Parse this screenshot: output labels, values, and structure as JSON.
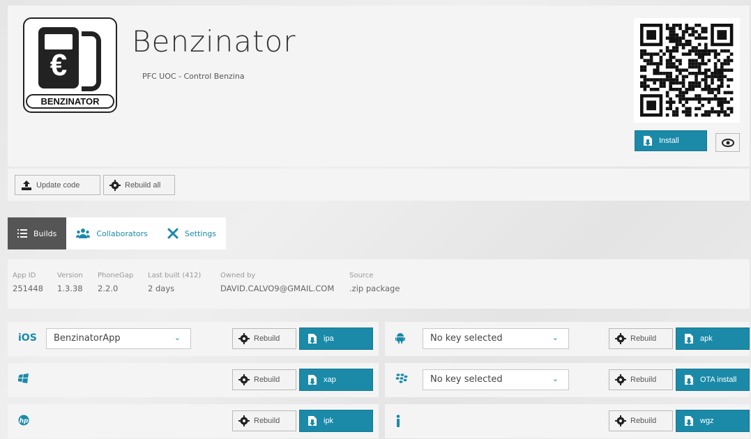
{
  "app": {
    "title": "Benzinator",
    "subtitle": "PFC UOC - Control Benzina",
    "logo_text": "BENZINATOR",
    "logo_symbol": "€"
  },
  "header": {
    "install_label": "Install"
  },
  "toolbar": {
    "update_label": "Update code",
    "rebuild_all_label": "Rebuild all"
  },
  "tabs": [
    {
      "label": "Builds",
      "icon": "list-icon"
    },
    {
      "label": "Collaborators",
      "icon": "users-icon"
    },
    {
      "label": "Settings",
      "icon": "tools-icon"
    }
  ],
  "info": {
    "app_id": {
      "label": "App ID",
      "value": "251448"
    },
    "version": {
      "label": "Version",
      "value": "1.3.38"
    },
    "phonegap": {
      "label": "PhoneGap",
      "value": "2.2.0"
    },
    "last_built": {
      "label": "Last built (412)",
      "value": "2 days"
    },
    "owner": {
      "label": "Owned by",
      "value": "DAVID.CALVO9@GMAIL.COM"
    },
    "source": {
      "label": "Source",
      "value": ".zip package"
    }
  },
  "platforms": {
    "ios": {
      "name": "iOS",
      "key": "BenzinatorApp",
      "rebuild": "Rebuild",
      "action": "ipa"
    },
    "android": {
      "icon": "android-icon",
      "key": "No key selected",
      "rebuild": "Rebuild",
      "action": "apk"
    },
    "windows": {
      "icon": "windows-icon",
      "rebuild": "Rebuild",
      "action": "xap"
    },
    "blackberry": {
      "icon": "blackberry-icon",
      "key": "No key selected",
      "rebuild": "Rebuild",
      "action": "OTA install"
    },
    "webos": {
      "icon": "hp-icon",
      "rebuild": "Rebuild",
      "action": "ipk"
    },
    "symbian": {
      "icon": "info-icon",
      "rebuild": "Rebuild",
      "action": "wgz"
    }
  },
  "colors": {
    "accent": "#1b8aa8",
    "tab_active": "#555555",
    "panel": "#f4f4f4"
  }
}
